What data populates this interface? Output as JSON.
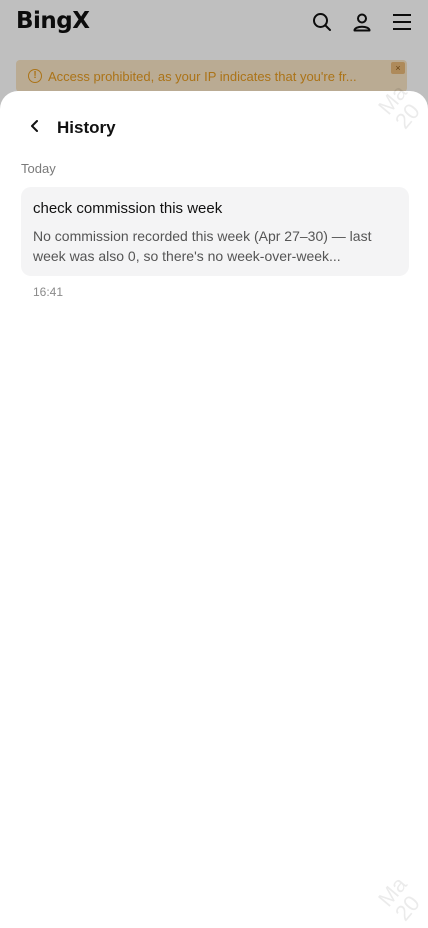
{
  "app": {
    "logo_text": "BingX",
    "icons": [
      "search-icon",
      "user-icon",
      "menu-icon"
    ]
  },
  "warning": {
    "text": "Access prohibited, as your IP indicates that you're fr...",
    "close_label": "×",
    "color": "#e59a1f"
  },
  "watermark": {
    "text": "Ma\n20"
  },
  "history": {
    "title": "History",
    "section": "Today",
    "items": [
      {
        "title": "check commission this week",
        "preview": "No commission recorded this week (Apr 27–30) — last week was also 0, so there's no week-over-week...",
        "time": "16:41"
      }
    ]
  }
}
